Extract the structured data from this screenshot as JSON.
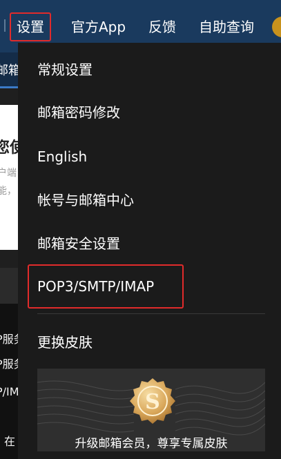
{
  "topnav": {
    "items": [
      {
        "label": "设置",
        "active": true
      },
      {
        "label": "官方App",
        "active": false
      },
      {
        "label": "反馈",
        "active": false
      },
      {
        "label": "自助查询",
        "active": false
      }
    ]
  },
  "background": {
    "tab_fragment": "邮箱",
    "card_heading_fragment": "您使",
    "card_line1_fragment": "户端",
    "card_line2_fragment": "能，",
    "lines": [
      "P服务",
      "P服务",
      "P/IM",
      "在"
    ]
  },
  "menu": {
    "items": [
      {
        "label": "常规设置"
      },
      {
        "label": "邮箱密码修改"
      },
      {
        "label": "English"
      },
      {
        "label": "帐号与邮箱中心"
      },
      {
        "label": "邮箱安全设置"
      },
      {
        "label": "POP3/SMTP/IMAP",
        "highlighted": true
      },
      {
        "label": "更换皮肤"
      }
    ],
    "promo": {
      "text": "升级邮箱会员，尊享专属皮肤",
      "icon": "vip-coin-icon"
    }
  },
  "colors": {
    "topbar": "#1a3a5e",
    "menu_bg": "#1b1b1b",
    "highlight_border": "#e22b2b",
    "badge_gold": "#d9a75a"
  }
}
